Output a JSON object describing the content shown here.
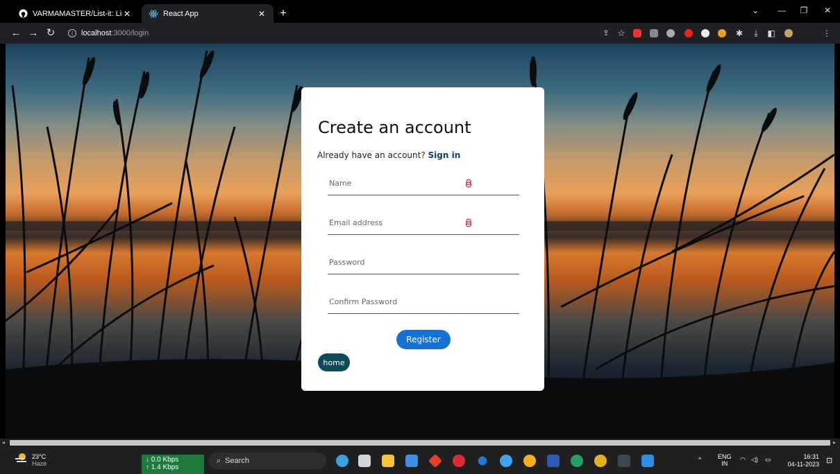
{
  "browser": {
    "tabs": [
      {
        "title": "VARMAMASTER/List-it: List it is",
        "active": false
      },
      {
        "title": "React App",
        "active": true
      }
    ],
    "url_host": "localhost",
    "url_path": ":3000/login"
  },
  "form": {
    "heading": "Create an account",
    "already_text": "Already have an account? ",
    "signin_label": "Sign in",
    "name_placeholder": "Name",
    "email_placeholder": "Email address",
    "password_placeholder": "Password",
    "confirm_placeholder": "Confirm Password",
    "register_label": "Register",
    "home_label": "home",
    "warning_color": "#d7263d"
  },
  "taskbar": {
    "temperature": "23°C",
    "weather": "Haze",
    "download": "↓ 0.0 Kbps",
    "upload": "↑ 1.4 Kbps",
    "search_label": "Search",
    "lang_top": "ENG",
    "lang_bottom": "IN",
    "time": "16:31",
    "date": "04-11-2023"
  }
}
